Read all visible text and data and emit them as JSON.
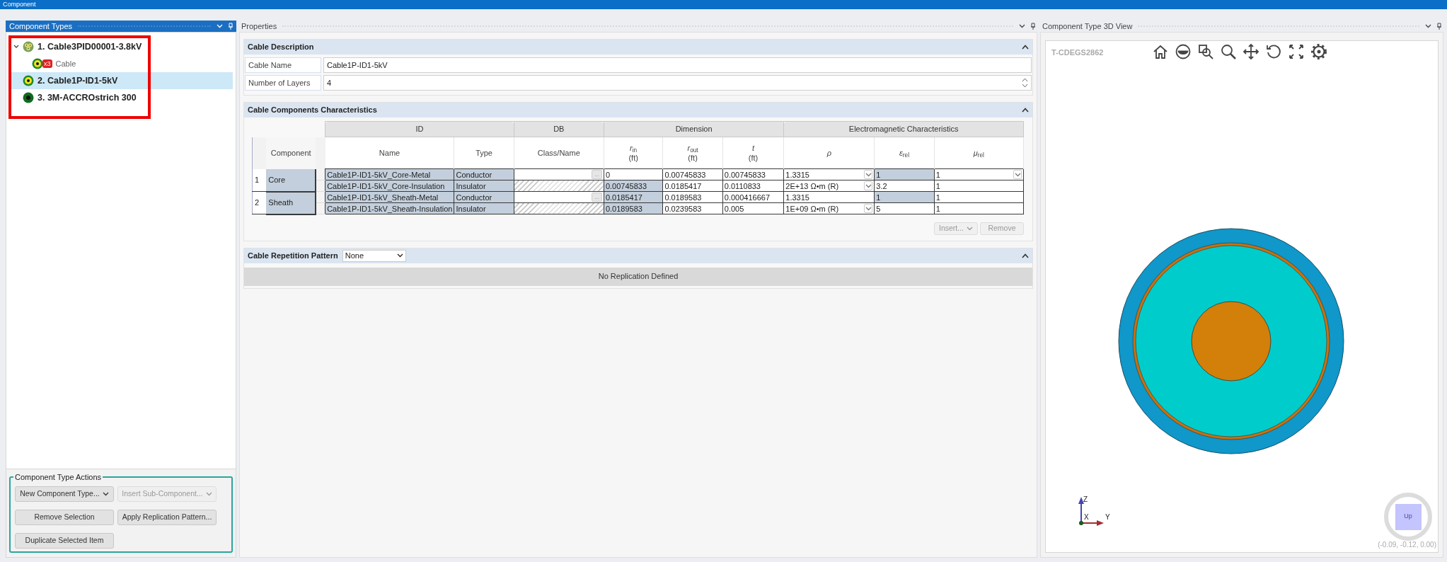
{
  "window": {
    "title": "Component"
  },
  "component_types": {
    "title": "Component Types",
    "highlighted": true,
    "items": [
      {
        "label": "1. Cable3PID00001-3.8kV",
        "kind": "group",
        "expanded": true,
        "selected": false,
        "children": [
          {
            "label": "Cable",
            "kind": "cable",
            "badge": "x3",
            "selected": false
          }
        ]
      },
      {
        "label": "2. Cable1P-ID1-5kV",
        "kind": "cable",
        "selected": true
      },
      {
        "label": "3. 3M-ACCROstrich 300",
        "kind": "conductor",
        "selected": false
      }
    ]
  },
  "actions": {
    "title": "Component Type Actions",
    "buttons": [
      {
        "label": "New Component Type...",
        "kind": "dropdown",
        "disabled": false
      },
      {
        "label": "Insert Sub-Component...",
        "kind": "dropdown",
        "disabled": true
      },
      {
        "label": "Remove Selection",
        "kind": "button",
        "disabled": false
      },
      {
        "label": "Apply Replication Pattern...",
        "kind": "button",
        "disabled": false
      },
      {
        "label": "Duplicate Selected Item",
        "kind": "button",
        "disabled": false
      }
    ]
  },
  "properties": {
    "title": "Properties",
    "cable_description": {
      "title": "Cable Description",
      "fields": [
        {
          "label": "Cable Name",
          "value": "Cable1P-ID1-5kV",
          "kind": "text"
        },
        {
          "label": "Number of Layers",
          "value": "4",
          "kind": "spin"
        }
      ]
    },
    "characteristics": {
      "title": "Cable Components Characteristics",
      "component_header": "Component",
      "column_groups": [
        {
          "label": "ID",
          "columns": [
            {
              "label": "Name"
            },
            {
              "label": "Type"
            }
          ]
        },
        {
          "label": "DB",
          "columns": [
            {
              "label": "Class/Name"
            }
          ]
        },
        {
          "label": "Dimension",
          "columns": [
            {
              "label": "*r*$_{in}$",
              "unit": "(ft)"
            },
            {
              "label": "*r*$_{out}$",
              "unit": "(ft)"
            },
            {
              "label": "*t*",
              "unit": "(ft)"
            }
          ]
        },
        {
          "label": "Electromagnetic Characteristics",
          "columns": [
            {
              "label": "*ρ*"
            },
            {
              "label": "*ε*$_{rel}$"
            },
            {
              "label": "*μ*$_{rel}$"
            }
          ]
        }
      ],
      "components": [
        {
          "index": "1",
          "name": "Core",
          "layers": [
            {
              "cells": [
                {
                  "value": "Cable1P-ID1-5kV_Core-Metal",
                  "kind": "readonly"
                },
                {
                  "value": "Conductor",
                  "kind": "readonly"
                },
                {
                  "kind": "browse",
                  "button": "..."
                },
                {
                  "value": "0",
                  "kind": "editable"
                },
                {
                  "value": "0.00745833",
                  "kind": "editable"
                },
                {
                  "value": "0.00745833",
                  "kind": "editable"
                },
                {
                  "value": "1.3315",
                  "kind": "dropdown"
                },
                {
                  "value": "1",
                  "kind": "readonly"
                },
                {
                  "value": "1",
                  "kind": "dropdown"
                }
              ]
            },
            {
              "cells": [
                {
                  "value": "Cable1P-ID1-5kV_Core-Insulation",
                  "kind": "readonly"
                },
                {
                  "value": "Insulator",
                  "kind": "readonly"
                },
                {
                  "kind": "hatched"
                },
                {
                  "value": "0.00745833",
                  "kind": "readonly"
                },
                {
                  "value": "0.0185417",
                  "kind": "editable"
                },
                {
                  "value": "0.0110833",
                  "kind": "editable"
                },
                {
                  "value": "2E+13 Ω•m (R)",
                  "kind": "dropdown"
                },
                {
                  "value": "3.2",
                  "kind": "editable"
                },
                {
                  "value": "1",
                  "kind": "editable"
                }
              ]
            }
          ]
        },
        {
          "index": "2",
          "name": "Sheath",
          "layers": [
            {
              "cells": [
                {
                  "value": "Cable1P-ID1-5kV_Sheath-Metal",
                  "kind": "readonly"
                },
                {
                  "value": "Conductor",
                  "kind": "readonly"
                },
                {
                  "kind": "browse",
                  "button": "..."
                },
                {
                  "value": "0.0185417",
                  "kind": "readonly"
                },
                {
                  "value": "0.0189583",
                  "kind": "editable"
                },
                {
                  "value": "0.000416667",
                  "kind": "editable"
                },
                {
                  "value": "1.3315",
                  "kind": "editable"
                },
                {
                  "value": "1",
                  "kind": "readonly"
                },
                {
                  "value": "1",
                  "kind": "editable"
                }
              ]
            },
            {
              "cells": [
                {
                  "value": "Cable1P-ID1-5kV_Sheath-Insulation",
                  "kind": "readonly"
                },
                {
                  "value": "Insulator",
                  "kind": "readonly"
                },
                {
                  "kind": "hatched"
                },
                {
                  "value": "0.0189583",
                  "kind": "readonly"
                },
                {
                  "value": "0.0239583",
                  "kind": "editable"
                },
                {
                  "value": "0.005",
                  "kind": "editable"
                },
                {
                  "value": "1E+09 Ω•m (R)",
                  "kind": "dropdown"
                },
                {
                  "value": "5",
                  "kind": "editable"
                },
                {
                  "value": "1",
                  "kind": "editable"
                }
              ]
            }
          ]
        }
      ],
      "buttons": [
        {
          "label": "Insert...",
          "kind": "dropdown",
          "disabled": true
        },
        {
          "label": "Remove",
          "kind": "button",
          "disabled": true
        }
      ]
    },
    "repetition": {
      "title": "Cable Repetition Pattern",
      "pattern": "None",
      "message": "No Replication Defined"
    }
  },
  "view_3d": {
    "title": "Component Type 3D View",
    "model_id": "T-CDEGS2862",
    "axes": [
      "Z",
      "X",
      "Y"
    ],
    "view_cube": "Up",
    "coordinates": "(-0.09, -0.12, 0.00)"
  }
}
